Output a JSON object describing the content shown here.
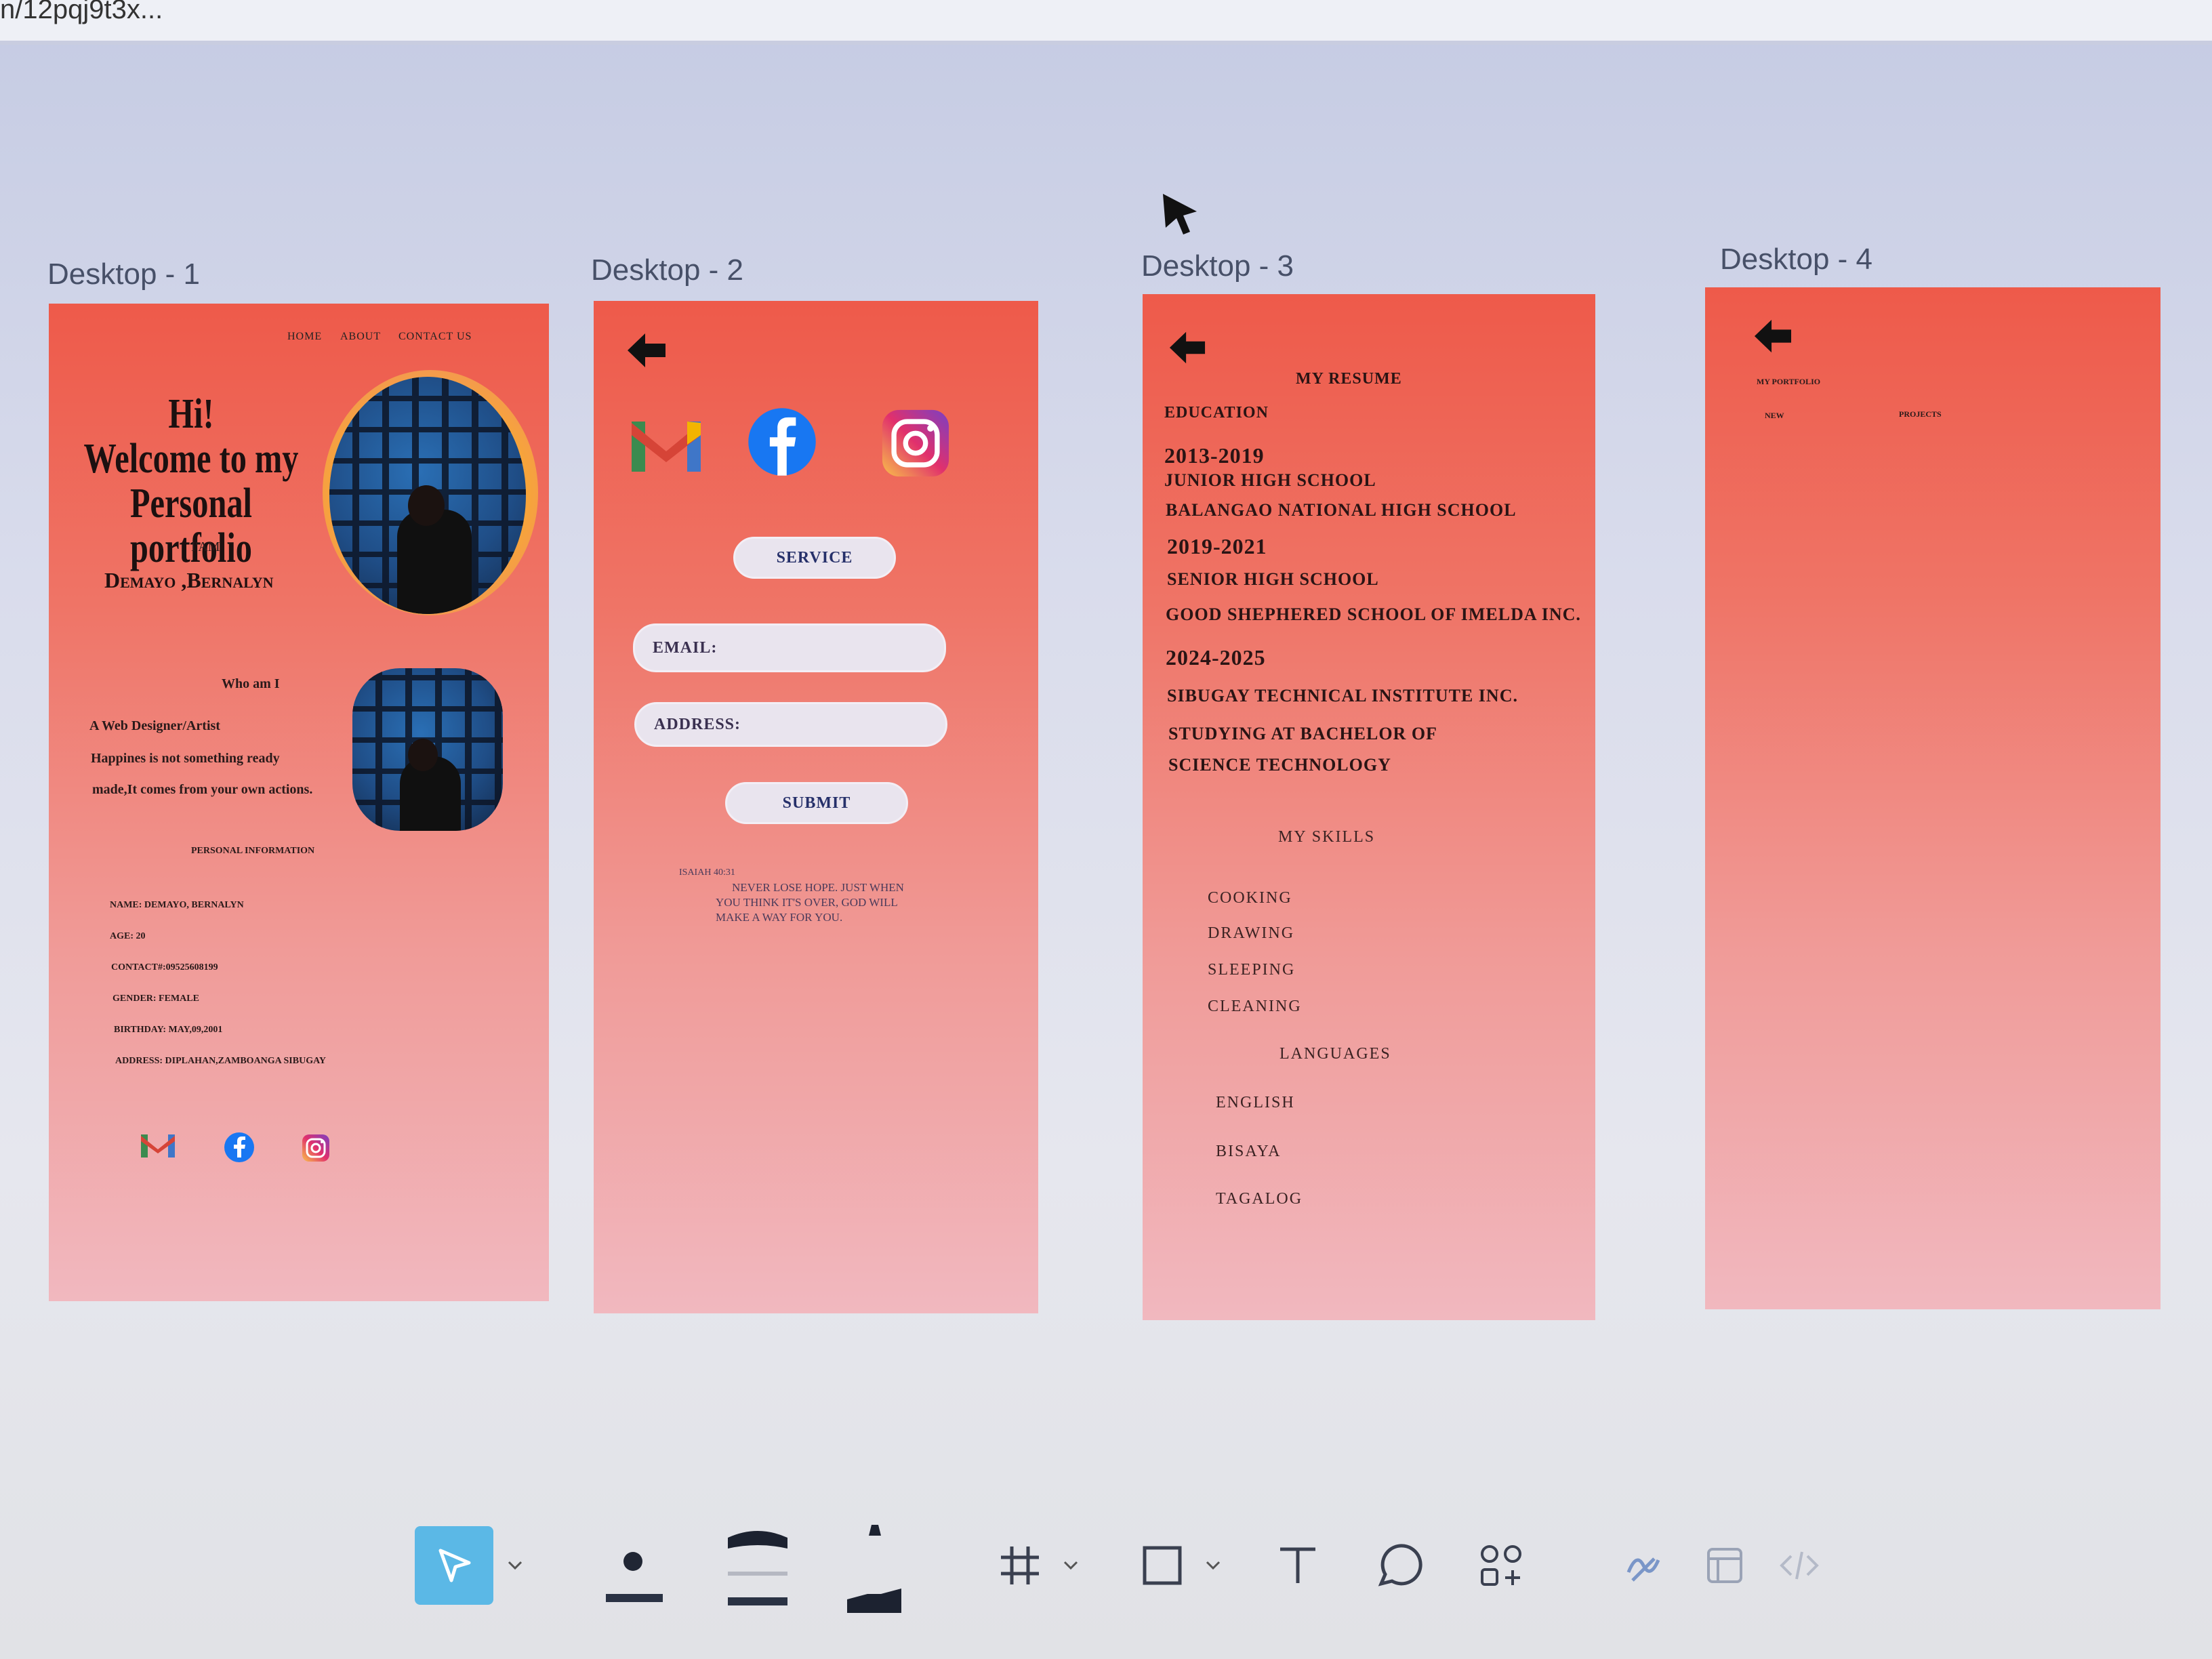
{
  "browser": {
    "tab_text": "n/12pqj9t3x..."
  },
  "frames": [
    {
      "label": "Desktop - 1"
    },
    {
      "label": "Desktop - 2"
    },
    {
      "label": "Desktop - 3"
    },
    {
      "label": "Desktop - 4"
    }
  ],
  "d1": {
    "nav": [
      "HOME",
      "ABOUT",
      "CONTACT US"
    ],
    "hero_line1": "Hi!",
    "hero_line2": "Welcome to my",
    "hero_line3": "Personal portfolio",
    "i_am": "I'AM",
    "name": "Demayo ,Bernalyn",
    "who_title": "Who am I",
    "who_line1": "A Web Designer/Artist",
    "who_line2": "Happines is not something ready",
    "who_line3": "made,It comes from your own actions.",
    "personal_heading": "PERSONAL INFORMATION",
    "info": [
      "NAME: DEMAYO, BERNALYN",
      "AGE: 20",
      "CONTACT#:09525608199",
      "GENDER: FEMALE",
      "BIRTHDAY: MAY,09,2001",
      "ADDRESS: DIPLAHAN,ZAMBOANGA SIBUGAY"
    ]
  },
  "d2": {
    "service": "SERVICE",
    "email": "EMAIL:",
    "address": "ADDRESS:",
    "submit": "SUBMIT",
    "quote_author": "ISAIAH 40:31",
    "quote_line1": "NEVER LOSE HOPE. JUST WHEN",
    "quote_line2": "YOU THINK IT'S OVER, GOD WILL",
    "quote_line3": "MAKE A WAY FOR YOU."
  },
  "d3": {
    "title": "MY RESUME",
    "education": "EDUCATION",
    "year1": "2013-2019",
    "jhs": "JUNIOR HIGH SCHOOL",
    "school1": "BALANGAO NATIONAL HIGH SCHOOL",
    "year2": "2019-2021",
    "shs": "SENIOR HIGH SCHOOL",
    "school2": "GOOD SHEPHERED SCHOOL OF IMELDA INC.",
    "year3": "2024-2025",
    "school3": "SIBUGAY TECHNICAL INSTITUTE INC.",
    "study1": "STUDYING AT BACHELOR OF",
    "study2": "SCIENCE TECHNOLOGY",
    "skills_title": "MY SKILLS",
    "skills": [
      "COOKING",
      "DRAWING",
      "SLEEPING",
      "CLEANING"
    ],
    "languages_title": "LANGUAGES",
    "languages": [
      "ENGLISH",
      "BISAYA",
      "TAGALOG"
    ]
  },
  "d4": {
    "title": "MY PORTFOLIO",
    "tab1": "NEW",
    "tab2": "PROJECTS"
  },
  "colors": {
    "frame_top": "#ee5a4a",
    "frame_bottom": "#f1b8bf",
    "select_tool": "#5bb8e6"
  },
  "icons": [
    "back-arrow-icon",
    "gmail-icon",
    "facebook-icon",
    "instagram-icon",
    "cursor-icon"
  ],
  "toolbar": [
    "move-tool",
    "pencil-tool",
    "marker-tool",
    "highlighter-tool",
    "frame-tool",
    "shape-tool",
    "text-tool",
    "comment-tool",
    "components-tool",
    "draw-tool",
    "dev-tool",
    "code-tool"
  ]
}
